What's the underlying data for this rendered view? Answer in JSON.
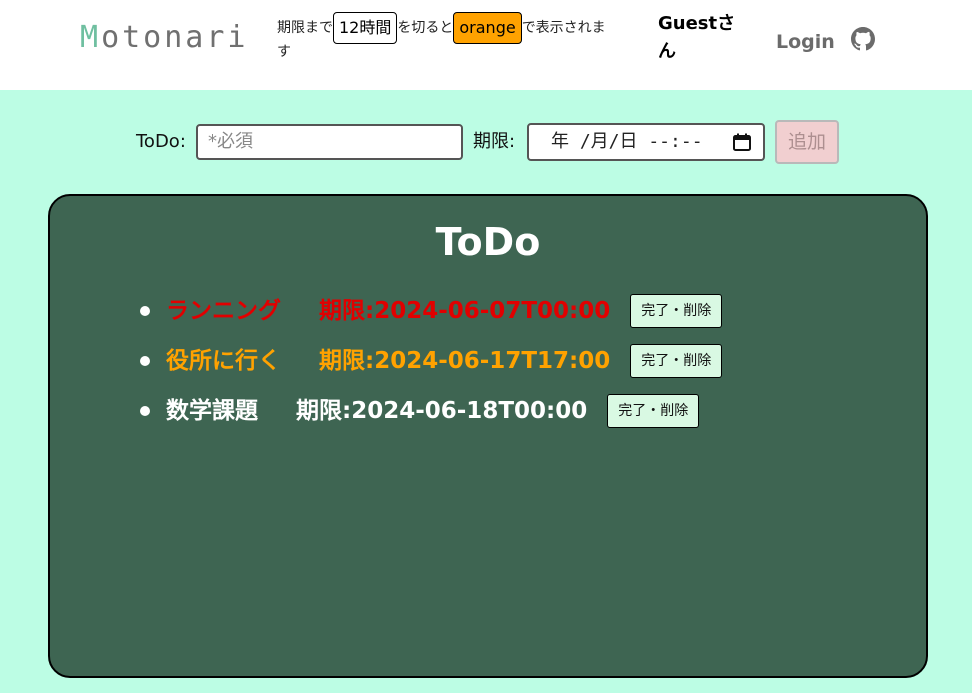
{
  "header": {
    "logo": {
      "first_letter": "M",
      "rest": "otonari"
    },
    "notice": {
      "part1": "期限まで",
      "threshold": "12時間",
      "part2": "を切ると",
      "color_word": "orange",
      "part3": "で表示されま",
      "part4": "す"
    },
    "guest_label": "Guestさん",
    "login_label": "Login",
    "github_icon": "github-icon"
  },
  "form": {
    "todo_label": "ToDo:",
    "todo_placeholder": "*必須",
    "limit_label": "期限:",
    "date_value": "年 /月/日 --:--",
    "add_label": "追加"
  },
  "panel": {
    "title": "ToDo",
    "items": [
      {
        "name": "ランニング",
        "deadline": "期限:2024-06-07T00:00",
        "button": "完了・削除",
        "status_color": "#e10000"
      },
      {
        "name": "役所に行く",
        "deadline": "期限:2024-06-17T17:00",
        "button": "完了・削除",
        "status_color": "#ffa200"
      },
      {
        "name": "数学課題",
        "deadline": "期限:2024-06-18T00:00",
        "button": "完了・削除",
        "status_color": "#ffffff"
      }
    ]
  },
  "colors": {
    "page_bg": "#bcfde4",
    "panel_bg": "#3e6552",
    "overdue": "#e10000",
    "near_deadline": "#ffa200",
    "add_button_bg": "#f1cfd0",
    "done_button_bg": "#d9f9e3"
  }
}
